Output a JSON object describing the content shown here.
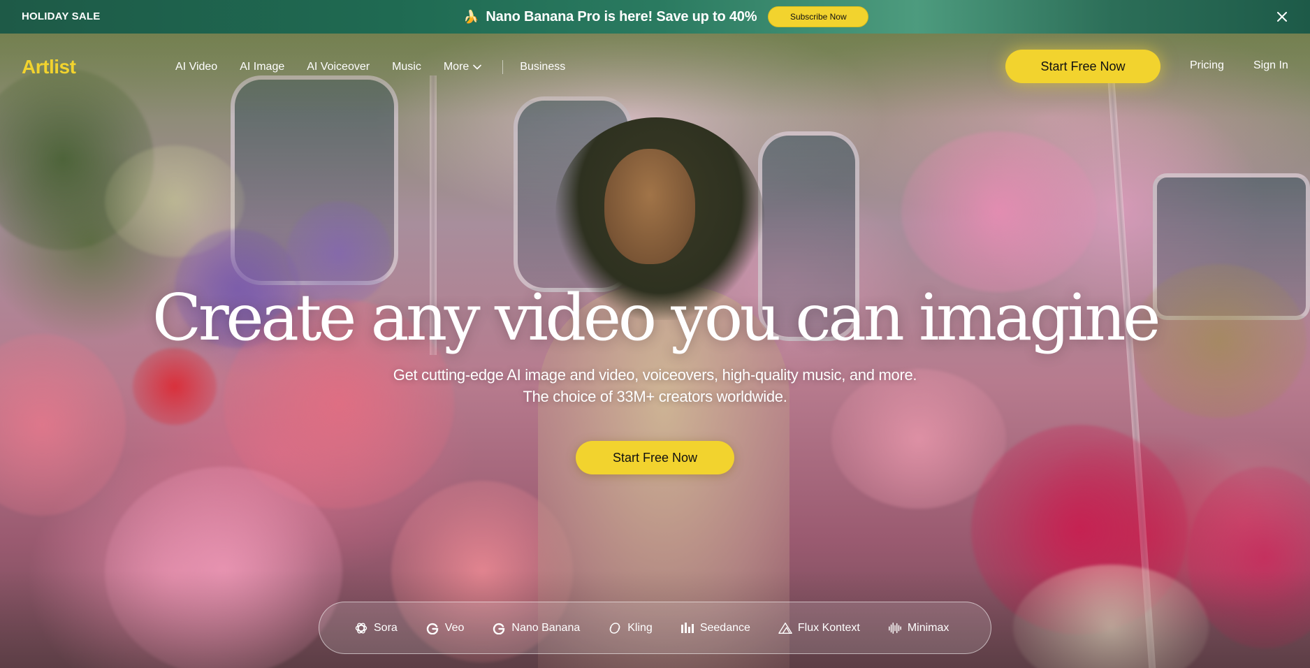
{
  "promo": {
    "label": "HOLIDAY SALE",
    "icon": "banana-icon",
    "text": "Nano Banana Pro is here! Save up to 40%",
    "subscribe_label": "Subscribe Now"
  },
  "nav": {
    "logo": "Artlist",
    "links": [
      "AI Video",
      "AI Image",
      "AI Voiceover",
      "Music",
      "More",
      "Business"
    ],
    "cta_label": "Start Free Now",
    "pricing_label": "Pricing",
    "signin_label": "Sign In"
  },
  "hero": {
    "headline": "Create any video you can imagine",
    "subline_1": "Get cutting-edge AI image and video, voiceovers, high-quality music, and more.",
    "subline_2": "The choice of 33M+ creators worldwide.",
    "cta_label": "Start Free Now"
  },
  "models": [
    {
      "label": "Sora",
      "icon": "openai-icon"
    },
    {
      "label": "Veo",
      "icon": "google-icon"
    },
    {
      "label": "Nano Banana",
      "icon": "google-icon"
    },
    {
      "label": "Kling",
      "icon": "kling-icon"
    },
    {
      "label": "Seedance",
      "icon": "seedance-icon"
    },
    {
      "label": "Flux Kontext",
      "icon": "flux-icon"
    },
    {
      "label": "Minimax",
      "icon": "minimax-icon"
    }
  ],
  "colors": {
    "accent_yellow": "#f2d32e",
    "promo_green": "#1f6a52"
  }
}
